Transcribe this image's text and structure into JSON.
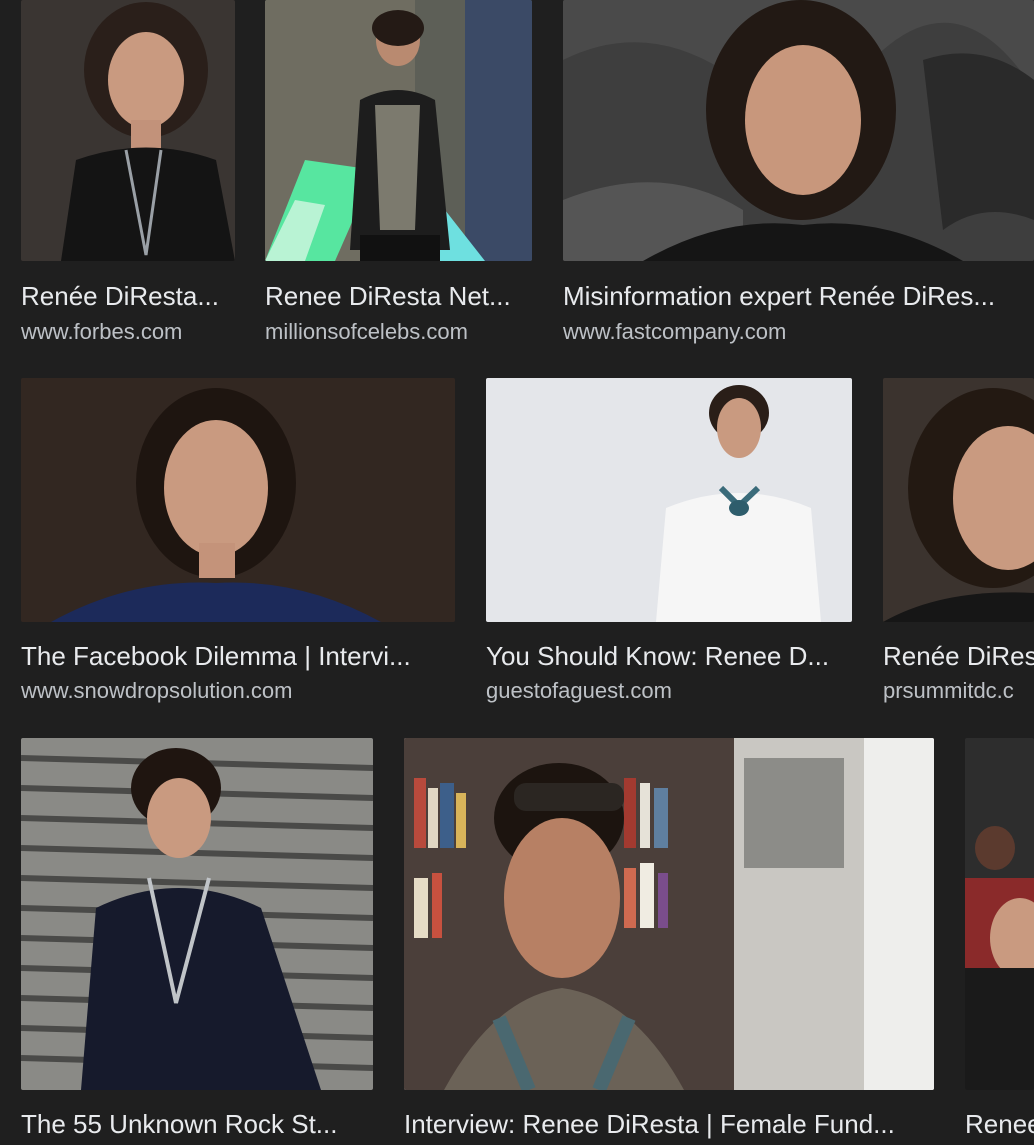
{
  "results": [
    {
      "title": "Renée DiResta...",
      "site": "www.forbes.com"
    },
    {
      "title": "Renee DiResta Net...",
      "site": "millionsofcelebs.com"
    },
    {
      "title": "Misinformation expert Renée DiRes...",
      "site": "www.fastcompany.com"
    },
    {
      "title": "The Facebook Dilemma | Intervi...",
      "site": "www.snowdropsolution.com"
    },
    {
      "title": "You Should Know: Renee D...",
      "site": "guestofaguest.com"
    },
    {
      "title": "Renée DiRes",
      "site": "prsummitdc.c"
    },
    {
      "title": "The 55 Unknown Rock St...",
      "site": ""
    },
    {
      "title": "Interview: Renee DiResta | Female Fund...",
      "site": ""
    },
    {
      "title": "Renee",
      "site": ""
    }
  ]
}
